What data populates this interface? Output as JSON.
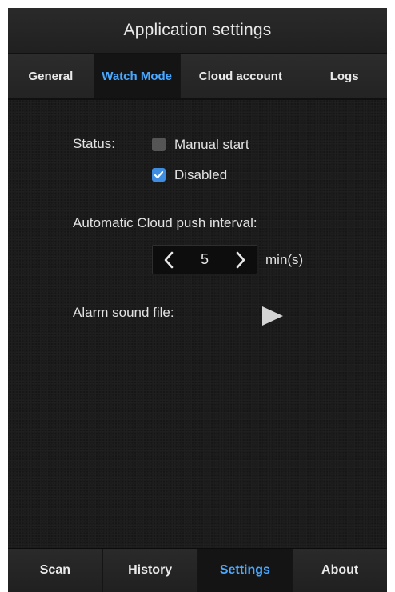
{
  "header": {
    "title": "Application settings"
  },
  "tabs": [
    {
      "label": "General"
    },
    {
      "label": "Watch Mode",
      "active": true
    },
    {
      "label": "Cloud account"
    },
    {
      "label": "Logs"
    }
  ],
  "watch_mode": {
    "status_label": "Status:",
    "options": [
      {
        "label": "Manual start",
        "checked": false
      },
      {
        "label": "Disabled",
        "checked": true
      }
    ],
    "push_interval_label": "Automatic Cloud push interval:",
    "push_interval_value": "5",
    "push_interval_unit": "min(s)",
    "alarm_label": "Alarm sound file:",
    "play_icon": "play-icon"
  },
  "bottom_nav": [
    {
      "label": "Scan"
    },
    {
      "label": "History"
    },
    {
      "label": "Settings",
      "active": true
    },
    {
      "label": "About"
    }
  ],
  "colors": {
    "accent": "#4aa8ff",
    "checkbox_checked": "#3e8de0",
    "background": "#1b1b1b"
  }
}
